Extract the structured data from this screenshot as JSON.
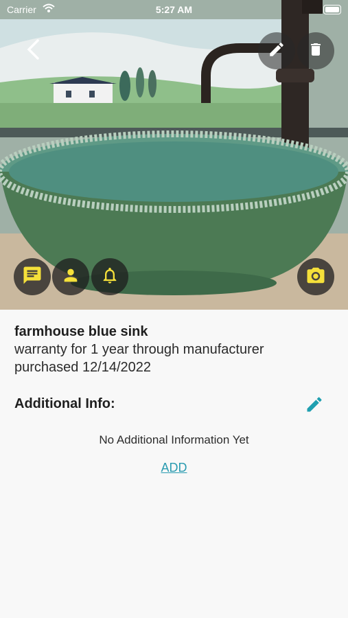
{
  "status_bar": {
    "carrier": "Carrier",
    "time": "5:27 AM"
  },
  "hero": {
    "photo_subject": "green vessel sink with dark faucet",
    "top_actions": [
      "back-icon",
      "edit-icon",
      "trash-icon"
    ],
    "bottom_actions": [
      "notes-icon",
      "person-icon",
      "bell-icon",
      "camera-icon"
    ],
    "accent_color": "#f5e03a"
  },
  "item": {
    "name": "farmhouse blue sink",
    "warranty": "warranty for 1 year through manufacturer",
    "purchased": "purchased 12/14/2022"
  },
  "additional_info": {
    "heading": "Additional Info:",
    "empty_text": "No Additional Information Yet",
    "add_label": "ADD",
    "edit_icon_color": "#1f9fb0"
  }
}
